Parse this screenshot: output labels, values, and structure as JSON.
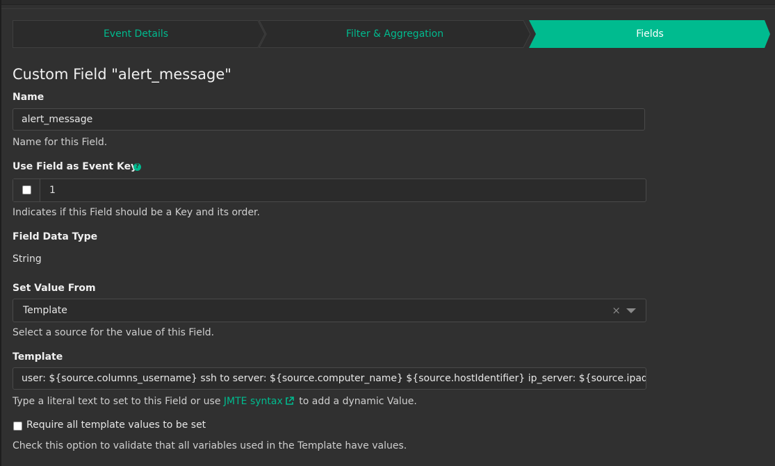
{
  "wizard": {
    "steps": [
      {
        "label": "Event Details",
        "active": false
      },
      {
        "label": "Filter & Aggregation",
        "active": false
      },
      {
        "label": "Fields",
        "active": true
      }
    ]
  },
  "heading": "Custom Field \"alert_message\"",
  "name_field": {
    "label": "Name",
    "value": "alert_message",
    "help": "Name for this Field."
  },
  "event_key": {
    "label": "Use Field as Event Key",
    "checked": false,
    "order": "1",
    "help": "Indicates if this Field should be a Key and its order."
  },
  "data_type": {
    "label": "Field Data Type",
    "value": "String"
  },
  "set_value_from": {
    "label": "Set Value From",
    "selected": "Template",
    "clear_symbol": "×",
    "help": "Select a source for the value of this Field."
  },
  "template": {
    "label": "Template",
    "value": "user: ${source.columns_username} ssh to server: ${source.computer_name} ${source.hostIdentifier} ip_server: ${source.ipaddress} from",
    "help_prefix": "Type a literal text to set to this Field or use ",
    "help_link": "JMTE syntax",
    "help_suffix": " to add a dynamic Value."
  },
  "require_all": {
    "label": "Require all template values to be set",
    "checked": false,
    "help": "Check this option to validate that all variables used in the Template have values."
  },
  "colors": {
    "accent": "#00bb8f",
    "background": "#303030",
    "input_bg": "#2b2b2b"
  }
}
